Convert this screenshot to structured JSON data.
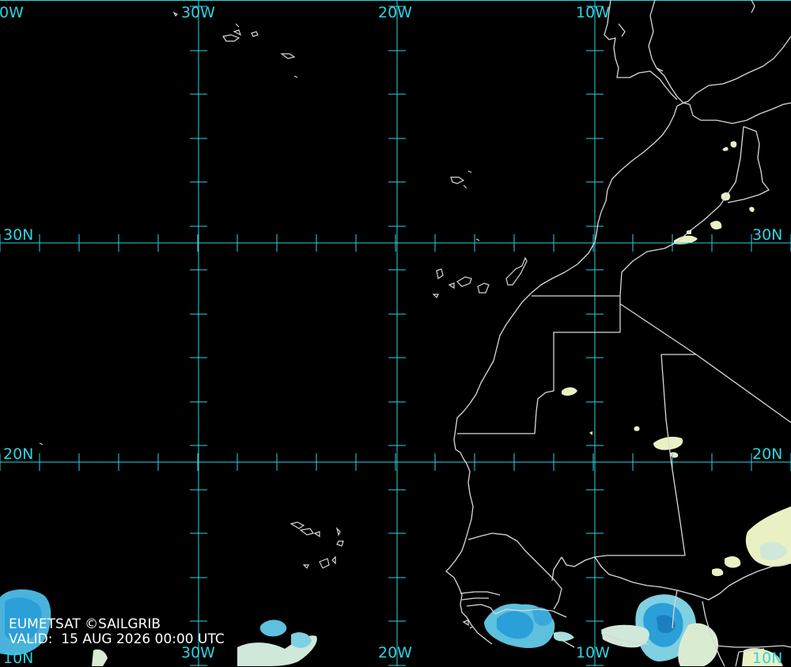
{
  "map": {
    "labels": {
      "lon_top": [
        "0W",
        "30W",
        "20W",
        "10W"
      ],
      "lon_bottom": [
        "30W",
        "20W",
        "10W"
      ],
      "lat_left": [
        "30N",
        "20N",
        "10N"
      ],
      "lat_right": [
        "30N",
        "20N",
        "10N"
      ]
    },
    "credit": "EUMETSAT ©SAILGRIB",
    "valid": "VALID:  15 AUG 2026 00:00 UTC",
    "colors": {
      "background": "#000000",
      "grid": "#2fd3e0",
      "coast": "#d8d8d8",
      "cloud_light": "#e9f1c4",
      "cloud_mid": "#7fd0e0",
      "cloud_deep": "#2a9fd8"
    }
  }
}
